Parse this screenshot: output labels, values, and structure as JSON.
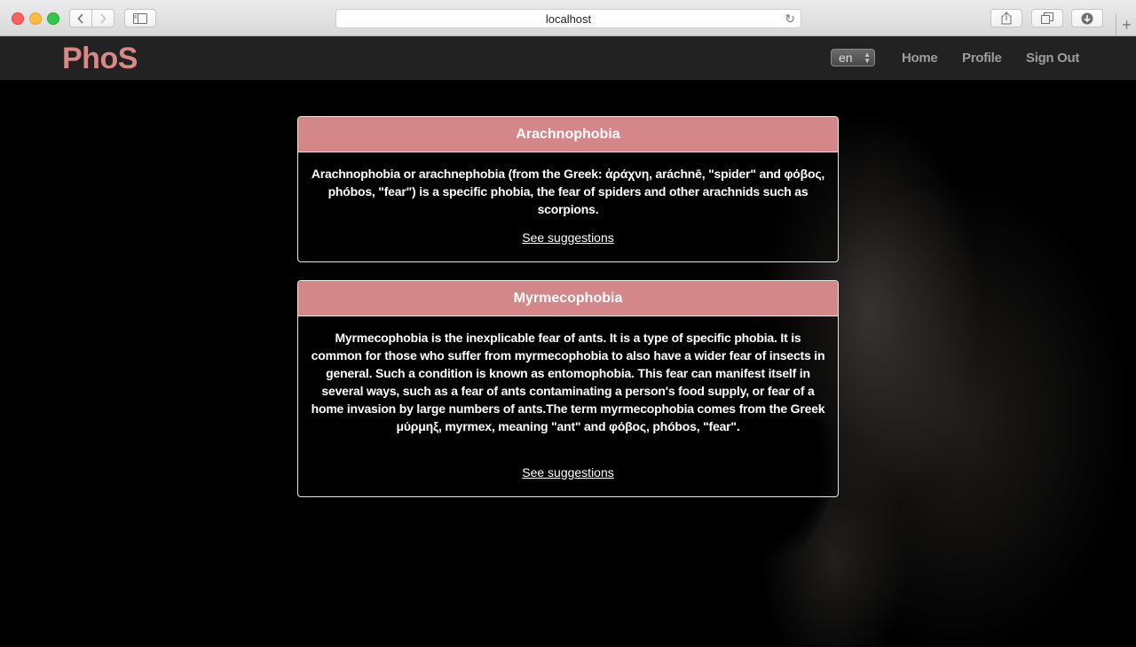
{
  "browser": {
    "address": "localhost",
    "reload_icon": "↻",
    "new_tab_icon": "+"
  },
  "navbar": {
    "brand": "PhoS",
    "language": "en",
    "links": {
      "home": "Home",
      "profile": "Profile",
      "signout": "Sign Out"
    }
  },
  "phobias": [
    {
      "title": "Arachnophobia",
      "description": "Arachnophobia or arachnephobia (from the Greek: ἀράχνη, aráchnē, \"spider\" and φόβος, phóbos, \"fear\") is a specific phobia, the fear of spiders and other arachnids such as scorpions.",
      "link": "See suggestions"
    },
    {
      "title": "Myrmecophobia",
      "description": "Myrmecophobia is the inexplicable fear of ants. It is a type of specific phobia. It is common for those who suffer from myrmecophobia to also have a wider fear of insects in general. Such a condition is known as entomophobia. This fear can manifest itself in several ways, such as a fear of ants contaminating a person's food supply, or fear of a home invasion by large numbers of ants.The term myrmecophobia comes from the Greek μύρμηξ, myrmex, meaning \"ant\" and φόβος, phóbos, \"fear\".",
      "link": "See suggestions"
    }
  ],
  "colors": {
    "brand": "#d98888",
    "card_header": "#d48789",
    "navbar_bg": "#222222"
  }
}
